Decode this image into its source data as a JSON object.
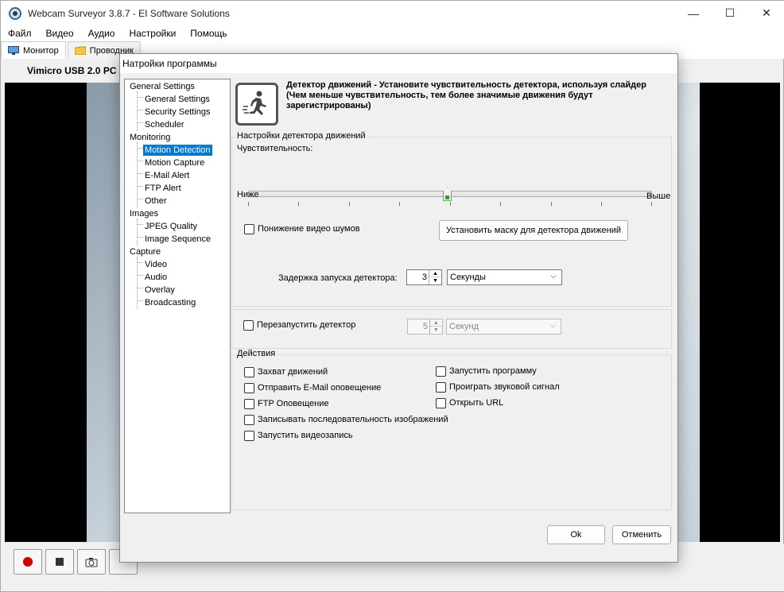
{
  "main": {
    "title": "Webcam Surveyor 3.8.7 - EI Software Solutions",
    "menu": [
      "Файл",
      "Видео",
      "Аудио",
      "Настройки",
      "Помощь"
    ],
    "tabs": [
      "Монитор",
      "Проводник"
    ],
    "camera_label": "Vimicro USB 2.0 PC"
  },
  "dialog": {
    "title": "Натройки программы",
    "tree": {
      "general": "General Settings",
      "general_settings": "General Settings",
      "security": "Security Settings",
      "scheduler": "Scheduler",
      "monitoring": "Monitoring",
      "motion_detection": "Motion Detection",
      "motion_capture": "Motion Capture",
      "email_alert": "E-Mail Alert",
      "ftp_alert": "FTP Alert",
      "other": "Other",
      "images": "Images",
      "jpeg": "JPEG Quality",
      "image_seq": "Image Sequence",
      "capture": "Capture",
      "video": "Video",
      "audio": "Audio",
      "overlay": "Overlay",
      "broadcasting": "Broadcasting"
    },
    "header": "Детектор движений - Установите чувствительность детектора, используя слайдер (Чем меньше чувствительность, тем более значимые движения будут зарегистрированы)",
    "detector_group": "Настройки детектора движений",
    "sensitivity_label": "Чувствительность:",
    "sensitivity_value": 0.5,
    "low_label": "Ниже",
    "high_label": "Выше",
    "noise_reduction": "Понижение видео шумов",
    "mask_button": "Установить маску для детектора движений",
    "delay_label": "Задержка запуска детектора:",
    "delay_value": "3",
    "delay_unit": "Секунды",
    "restart_label": "Перезапустить детектор",
    "restart_value": "5",
    "restart_unit": "Секунд",
    "actions_group": "Действия",
    "actions_left": [
      "Захват движений",
      "Отправить E-Mail  оповещение",
      "FTP Оповещение",
      "Записывать последовательность изображений",
      "Запустить видеозапись"
    ],
    "actions_right": [
      "Запустить программу",
      "Проиграть звуковой сигнал",
      "Открыть URL"
    ],
    "ok": "Ok",
    "cancel": "Отменить"
  },
  "colors": {
    "selection": "#0078d7",
    "record": "#d40000"
  }
}
